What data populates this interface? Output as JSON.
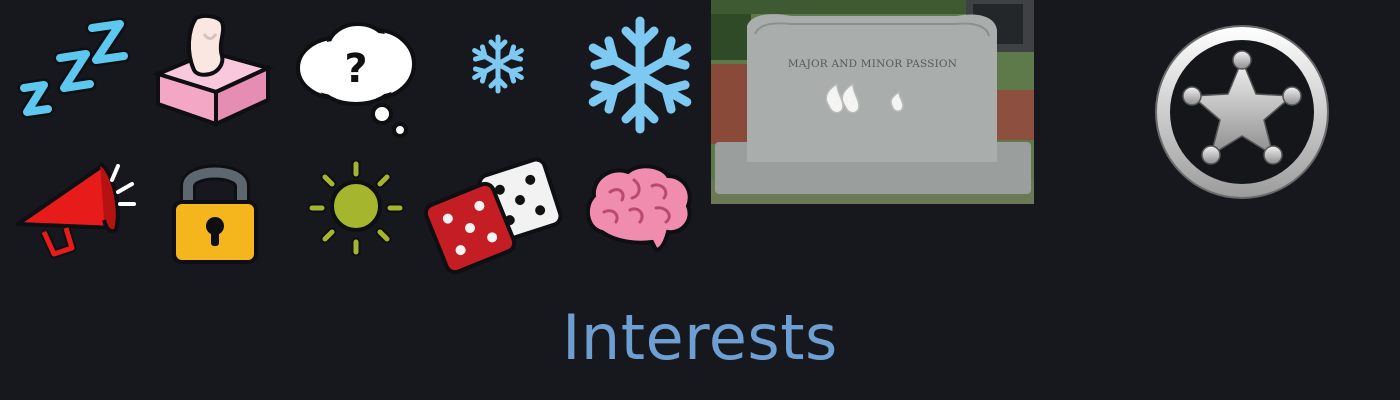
{
  "heading": {
    "title": "Interests"
  },
  "tombstone": {
    "inscription": "MAJOR AND MINOR PASSION"
  },
  "icons": [
    "sleep-zzz-icon",
    "tissue-box-icon",
    "thought-bubble-question-icon",
    "small-snowflake-icon",
    "large-snowflake-icon",
    "megaphone-icon",
    "padlock-icon",
    "lightbulb-sun-icon",
    "dice-icon",
    "brain-icon",
    "sheriff-star-badge-icon"
  ],
  "colors": {
    "background": "#16181e",
    "title": "#6e9fd2",
    "snowflake": "#7ec9f2",
    "zzz": "#5cc8f0",
    "megaphone": "#e81b1b",
    "padlock": "#f5b51c",
    "sun": "#a6b52e",
    "die_red": "#c41d24",
    "brain": "#f08cae",
    "tissue_box": "#f4a7c5",
    "badge_ring": "#cfcfcf"
  }
}
